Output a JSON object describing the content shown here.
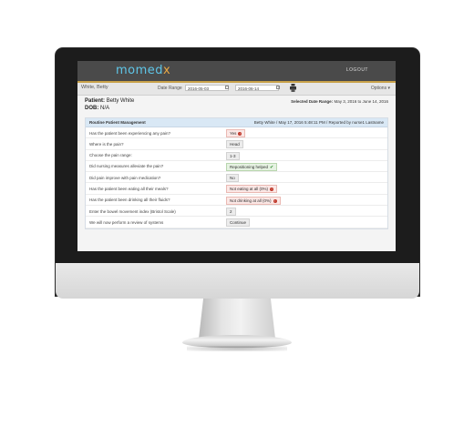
{
  "header": {
    "logo_main": "momed",
    "logo_accent": "x",
    "logout": "LOGOUT"
  },
  "filters": {
    "patient_name": "White, Betty",
    "date_range_label": "Date Range",
    "start_date": "2016-05-03",
    "end_date": "2016-06-14",
    "options": "Options ▾"
  },
  "patient": {
    "patient_label": "Patient:",
    "patient_name": "Betty White",
    "dob_label": "DOB:",
    "dob": "N/A",
    "selected_range_label": "Selected Date Range:",
    "selected_range": "May 3, 2016 to June 14, 2016"
  },
  "card": {
    "title": "Routine Patient Management",
    "meta": "Betty White / May 17, 2016 5:48:11 PM / Reported by nurse1 Lastname",
    "rows": [
      {
        "question": "Has the patient been experiencing any pain?",
        "answer": "Yes"
      },
      {
        "question": "Where is the pain?",
        "answer": "Head"
      },
      {
        "question": "Choose the pain range:",
        "answer": "1-3"
      },
      {
        "question": "Did nursing measures alleviate the pain?",
        "answer": "Repositioning helped"
      },
      {
        "question": "Did pain improve with pain medication?",
        "answer": "No"
      },
      {
        "question": "Has the patient been eating all their meals?",
        "answer": "Not eating at all (0%)"
      },
      {
        "question": "Has the patient been drinking all their fluids?",
        "answer": "Not drinking at all (0%)"
      },
      {
        "question": "Enter the bowel movement index (Bristol Scale)",
        "answer": "2"
      },
      {
        "question": "We will now perform a review of systems",
        "answer": "Continue"
      }
    ]
  },
  "icons": {
    "alert": "alert-icon",
    "check": "check-icon",
    "calendar": "calendar-icon",
    "print": "print-icon"
  },
  "colors": {
    "accent": "#5fc6e8",
    "alert": "#c0392b",
    "ok": "#2e8b2e",
    "header": "#4a4a4a"
  }
}
